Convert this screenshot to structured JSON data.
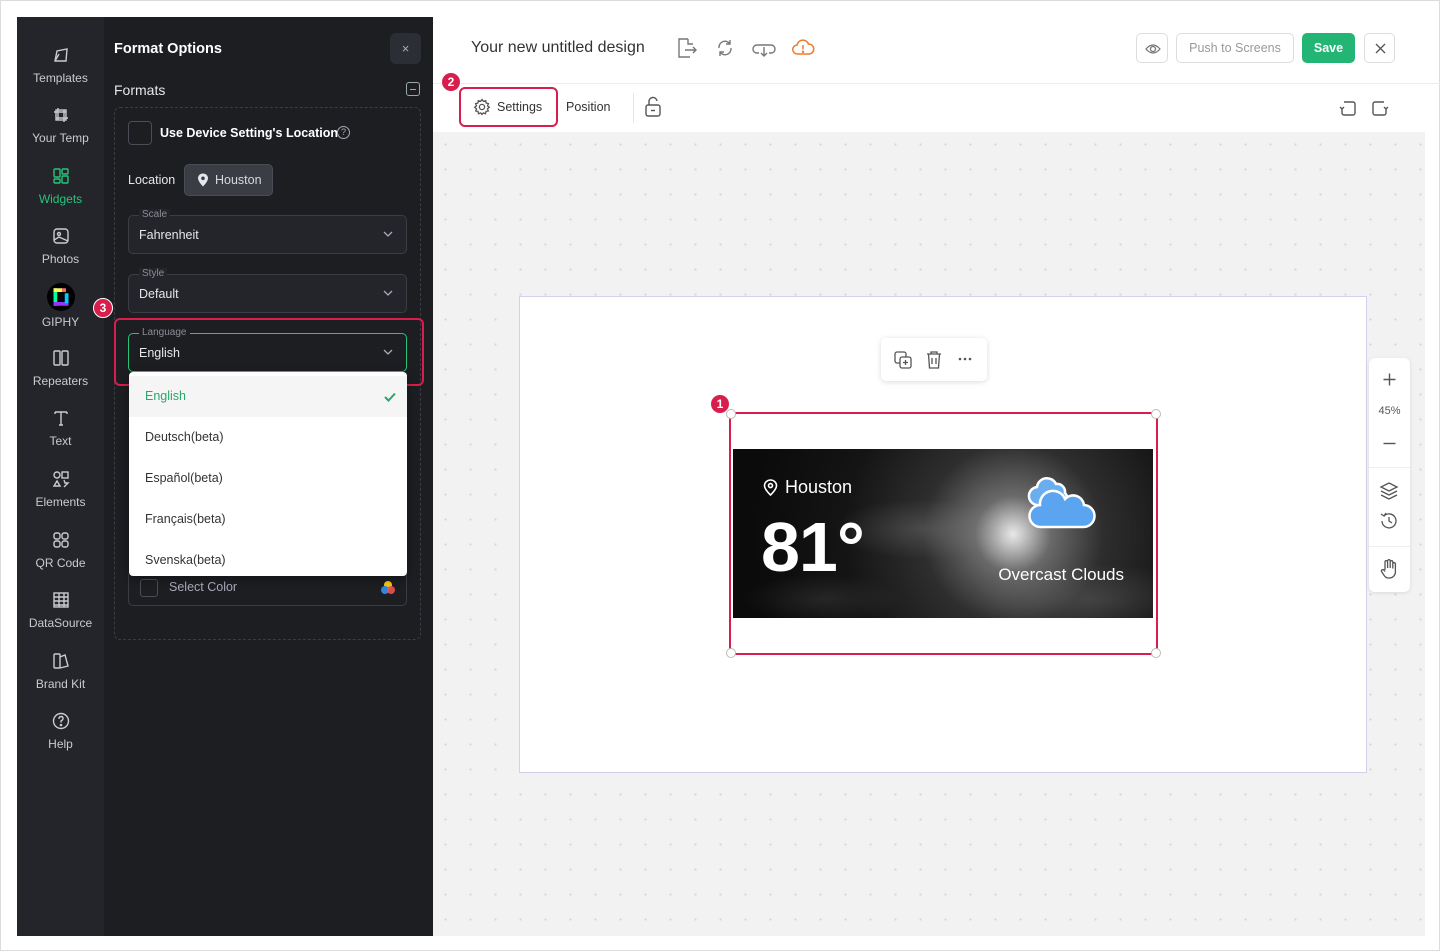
{
  "rail": {
    "items": [
      {
        "label": "Templates",
        "icon": "templates-icon"
      },
      {
        "label": "Your Temp",
        "icon": "your-templates-icon"
      },
      {
        "label": "Widgets",
        "icon": "widgets-icon",
        "active": true
      },
      {
        "label": "Photos",
        "icon": "photos-icon"
      },
      {
        "label": "GIPHY",
        "icon": "giphy-icon"
      },
      {
        "label": "Repeaters",
        "icon": "repeaters-icon"
      },
      {
        "label": "Text",
        "icon": "text-icon"
      },
      {
        "label": "Elements",
        "icon": "elements-icon"
      },
      {
        "label": "QR Code",
        "icon": "qr-code-icon"
      },
      {
        "label": "DataSource",
        "icon": "datasource-icon"
      },
      {
        "label": "Brand Kit",
        "icon": "brand-kit-icon"
      },
      {
        "label": "Help",
        "icon": "help-icon"
      }
    ]
  },
  "panel": {
    "title": "Format Options",
    "close": "×",
    "formats_label": "Formats",
    "device_location_label": "Use Device Setting's Location",
    "help_glyph": "?",
    "location_label": "Location",
    "location_value": "Houston",
    "scale": {
      "label": "Scale",
      "value": "Fahrenheit"
    },
    "style": {
      "label": "Style",
      "value": "Default"
    },
    "language": {
      "label": "Language",
      "value": "English"
    },
    "language_options": [
      "English",
      "Deutsch(beta)",
      "Español(beta)",
      "Français(beta)",
      "Svenska(beta)"
    ],
    "color_label": "Select Color"
  },
  "annotations": {
    "one": "1",
    "two": "2",
    "three": "3"
  },
  "header": {
    "title": "Your new untitled design",
    "push_label": "Push to Screens",
    "save_label": "Save"
  },
  "toolbar": {
    "settings_label": "Settings",
    "position_label": "Position"
  },
  "widget": {
    "location": "Houston",
    "temperature": "81°",
    "condition": "Overcast Clouds"
  },
  "zoom": {
    "level": "45%"
  },
  "colors": {
    "accent": "#27c47a",
    "save": "#22b573",
    "highlight": "#d81e4c",
    "panel_bg": "#1c1e22"
  }
}
